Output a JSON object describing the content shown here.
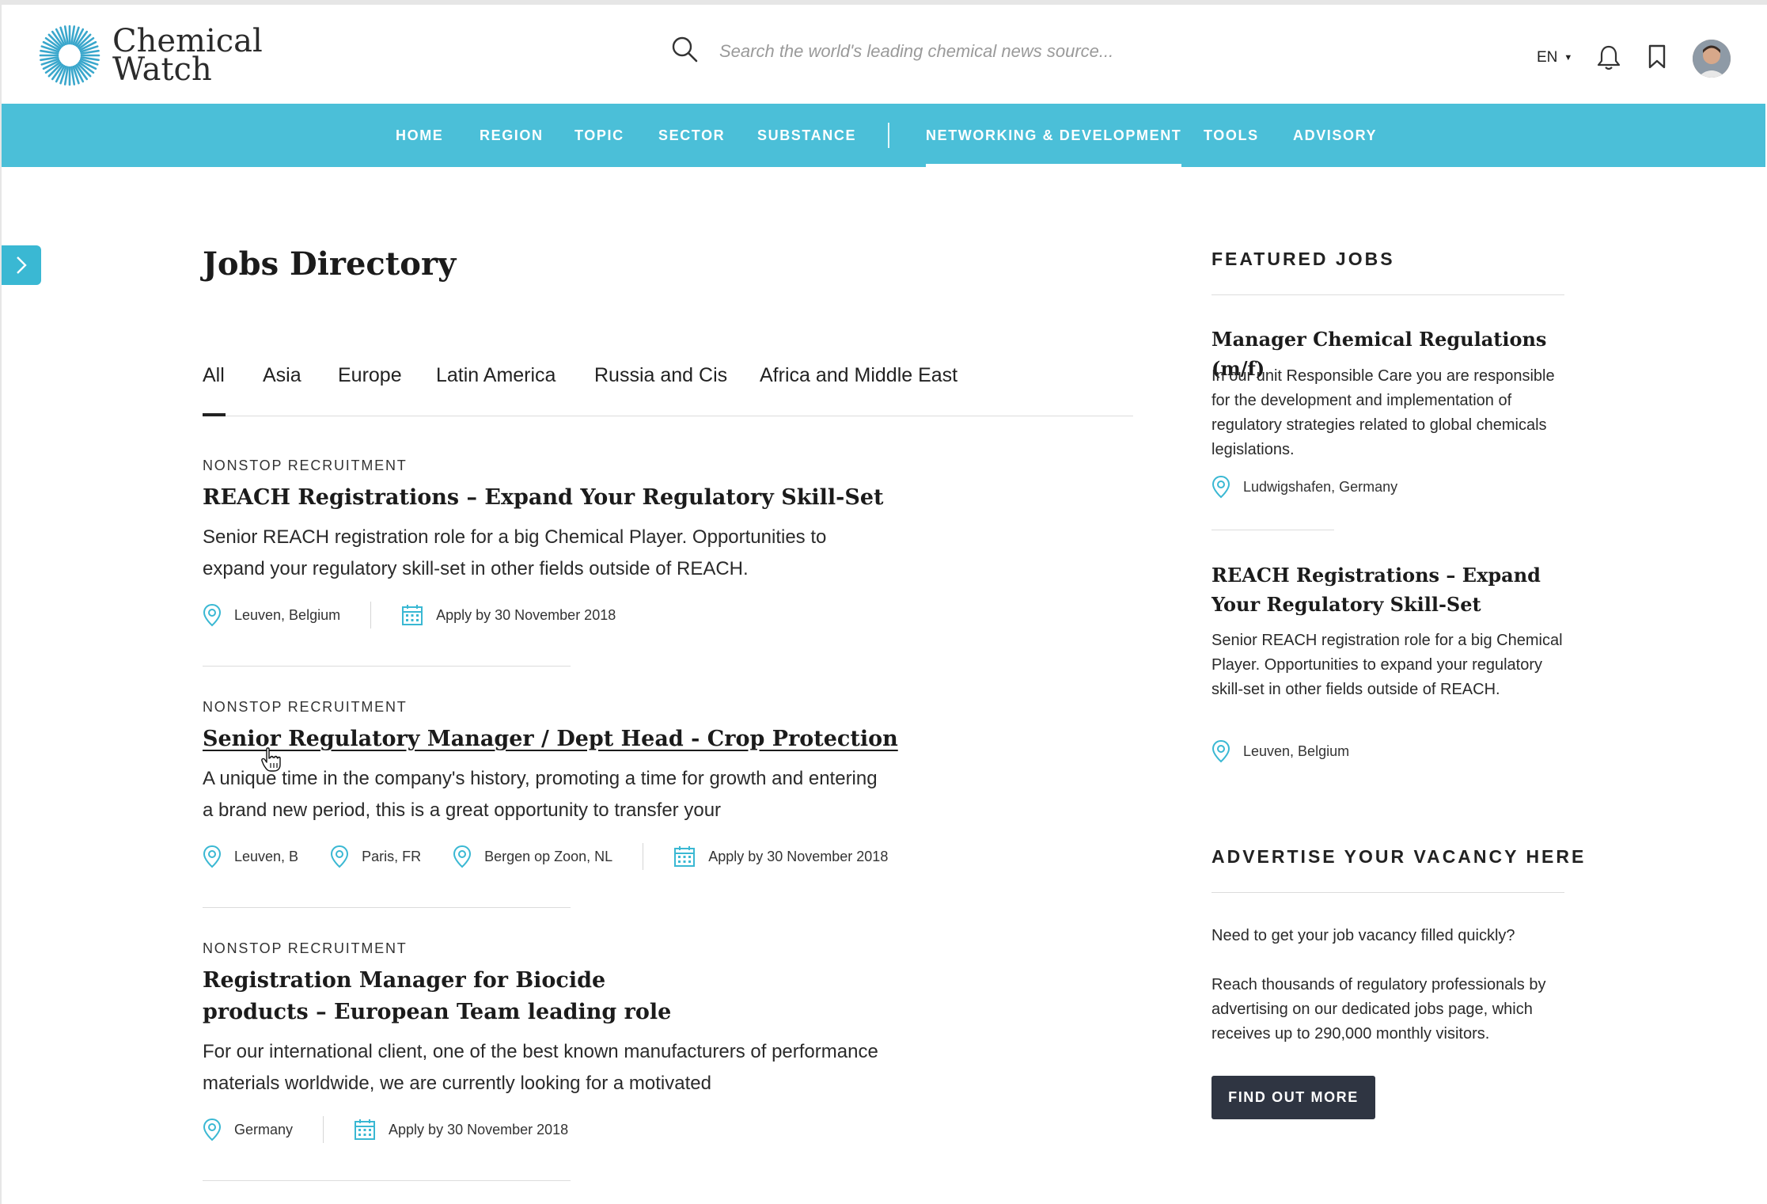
{
  "brand": {
    "name_line1": "Chemical",
    "name_line2": "Watch",
    "accent": "#4bbfd8"
  },
  "search": {
    "placeholder": "Search the world's leading chemical news source...",
    "icon": "search-icon"
  },
  "header": {
    "language": "EN",
    "icons": [
      "bell-icon",
      "bookmark-icon",
      "avatar"
    ]
  },
  "nav": {
    "items": [
      "HOME",
      "REGION",
      "TOPIC",
      "SECTOR",
      "SUBSTANCE",
      "NETWORKING & DEVELOPMENT",
      "TOOLS",
      "ADVISORY"
    ],
    "active": "NETWORKING & DEVELOPMENT"
  },
  "page": {
    "title": "Jobs Directory"
  },
  "tabs": {
    "items": [
      "All",
      "Asia",
      "Europe",
      "Latin America",
      "Russia and Cis",
      "Africa and Middle East"
    ],
    "active": "All"
  },
  "jobs": [
    {
      "company": "NONSTOP RECRUITMENT",
      "title": "REACH Registrations – Expand Your Regulatory Skill-Set",
      "desc": "Senior REACH registration role for a big Chemical Player. Opportunities to expand your regulatory skill-set in other fields outside of REACH.",
      "locations": [
        "Leuven, Belgium"
      ],
      "apply": "Apply by 30 November 2018"
    },
    {
      "company": "NONSTOP RECRUITMENT",
      "title": "Senior Regulatory Manager / Dept Head - Crop Protection",
      "desc": "A unique time in the company's history, promoting a time for growth and entering a brand new period, this is a great opportunity to transfer your",
      "locations": [
        "Leuven, B",
        "Paris, FR",
        "Bergen op Zoon, NL"
      ],
      "apply": "Apply by 30 November 2018"
    },
    {
      "company": "NONSTOP RECRUITMENT",
      "title": "Registration Manager for Biocide products – European Team leading role",
      "desc": "For our international client, one of the best known manufacturers of performance materials worldwide, we are currently looking for a motivated",
      "locations": [
        "Germany"
      ],
      "apply": "Apply by 30 November 2018"
    }
  ],
  "featured": {
    "heading": "FEATURED JOBS",
    "items": [
      {
        "title": "Manager Chemical Regulations (m/f)",
        "desc": "In our unit Responsible Care you are responsible for the development and implementation of regulatory strategies related to global chemicals legislations.",
        "location": "Ludwigshafen, Germany"
      },
      {
        "title": "REACH Registrations – Expand Your Regulatory Skill-Set",
        "desc": "Senior REACH registration role for a big Chemical Player. Opportunities to expand your regulatory skill-set in other fields outside of REACH.",
        "location": "Leuven, Belgium"
      }
    ]
  },
  "advertise": {
    "heading": "ADVERTISE YOUR VACANCY HERE",
    "p1": "Need to get your job vacancy filled quickly?",
    "p2": "Reach thousands of regulatory professionals by advertising on our dedicated jobs page, which receives up to 290,000 monthly visitors.",
    "button": "FIND OUT MORE"
  }
}
